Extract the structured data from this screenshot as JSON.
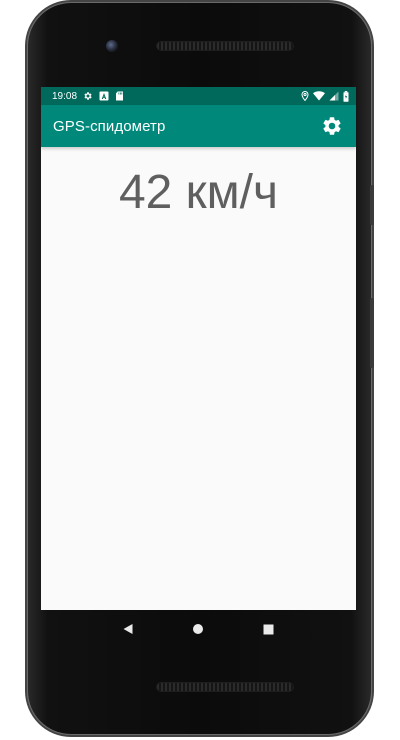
{
  "status_bar": {
    "time": "19:08",
    "left_icons": [
      "gear-icon",
      "a-badge-icon",
      "sd-card-icon"
    ],
    "right_icons": [
      "location-pin-icon",
      "wifi-icon",
      "signal-icon",
      "battery-icon"
    ]
  },
  "app_bar": {
    "title": "GPS-спидометр",
    "settings_icon": "gear-icon",
    "color": "#00897b",
    "status_color": "#00695c"
  },
  "main": {
    "speed_text": "42 км/ч",
    "text_color": "#5f5f5f"
  },
  "nav_bar": {
    "buttons": [
      "back-icon",
      "home-icon",
      "recents-icon"
    ]
  }
}
